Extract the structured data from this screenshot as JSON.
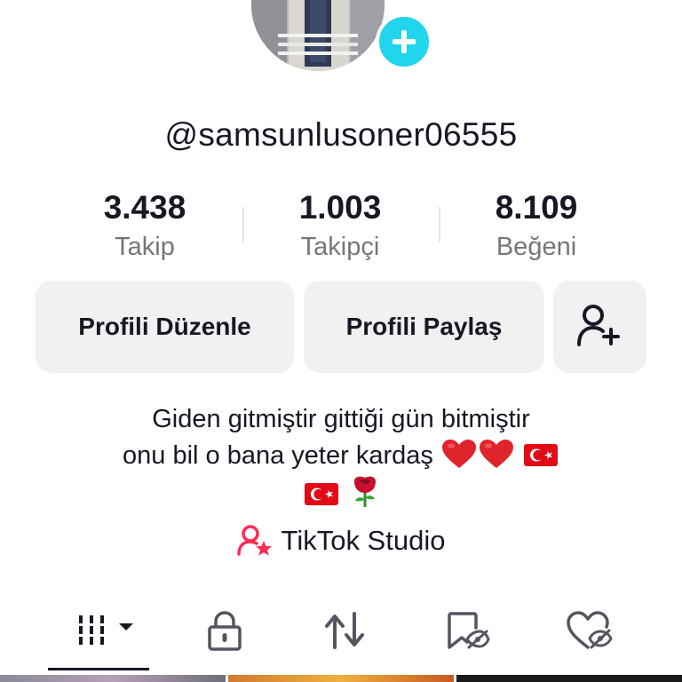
{
  "profile": {
    "username": "@samsunlusoner06555"
  },
  "stats": [
    {
      "value": "3.438",
      "label": "Takip"
    },
    {
      "value": "1.003",
      "label": "Takipçi"
    },
    {
      "value": "8.109",
      "label": "Beğeni"
    }
  ],
  "actions": {
    "edit_profile": "Profili Düzenle",
    "share_profile": "Profili Paylaş"
  },
  "bio": {
    "line1": "Giden gitmiştir gittiği gün bitmiştir",
    "line2": "onu bil o bana yeter kardaş"
  },
  "studio": {
    "label": "TikTok Studio"
  },
  "tabs": [
    {
      "icon": "grid-icon",
      "selected": true
    },
    {
      "icon": "lock-icon",
      "selected": false
    },
    {
      "icon": "repost-icon",
      "selected": false
    },
    {
      "icon": "bookmark-icon",
      "selected": false
    },
    {
      "icon": "liked-icon",
      "selected": false
    }
  ],
  "colors": {
    "accent_add": "#20d5ec",
    "studio_pink": "#fe2c55",
    "button_bg": "#f1f1f2",
    "secondary_text": "#75767c"
  }
}
